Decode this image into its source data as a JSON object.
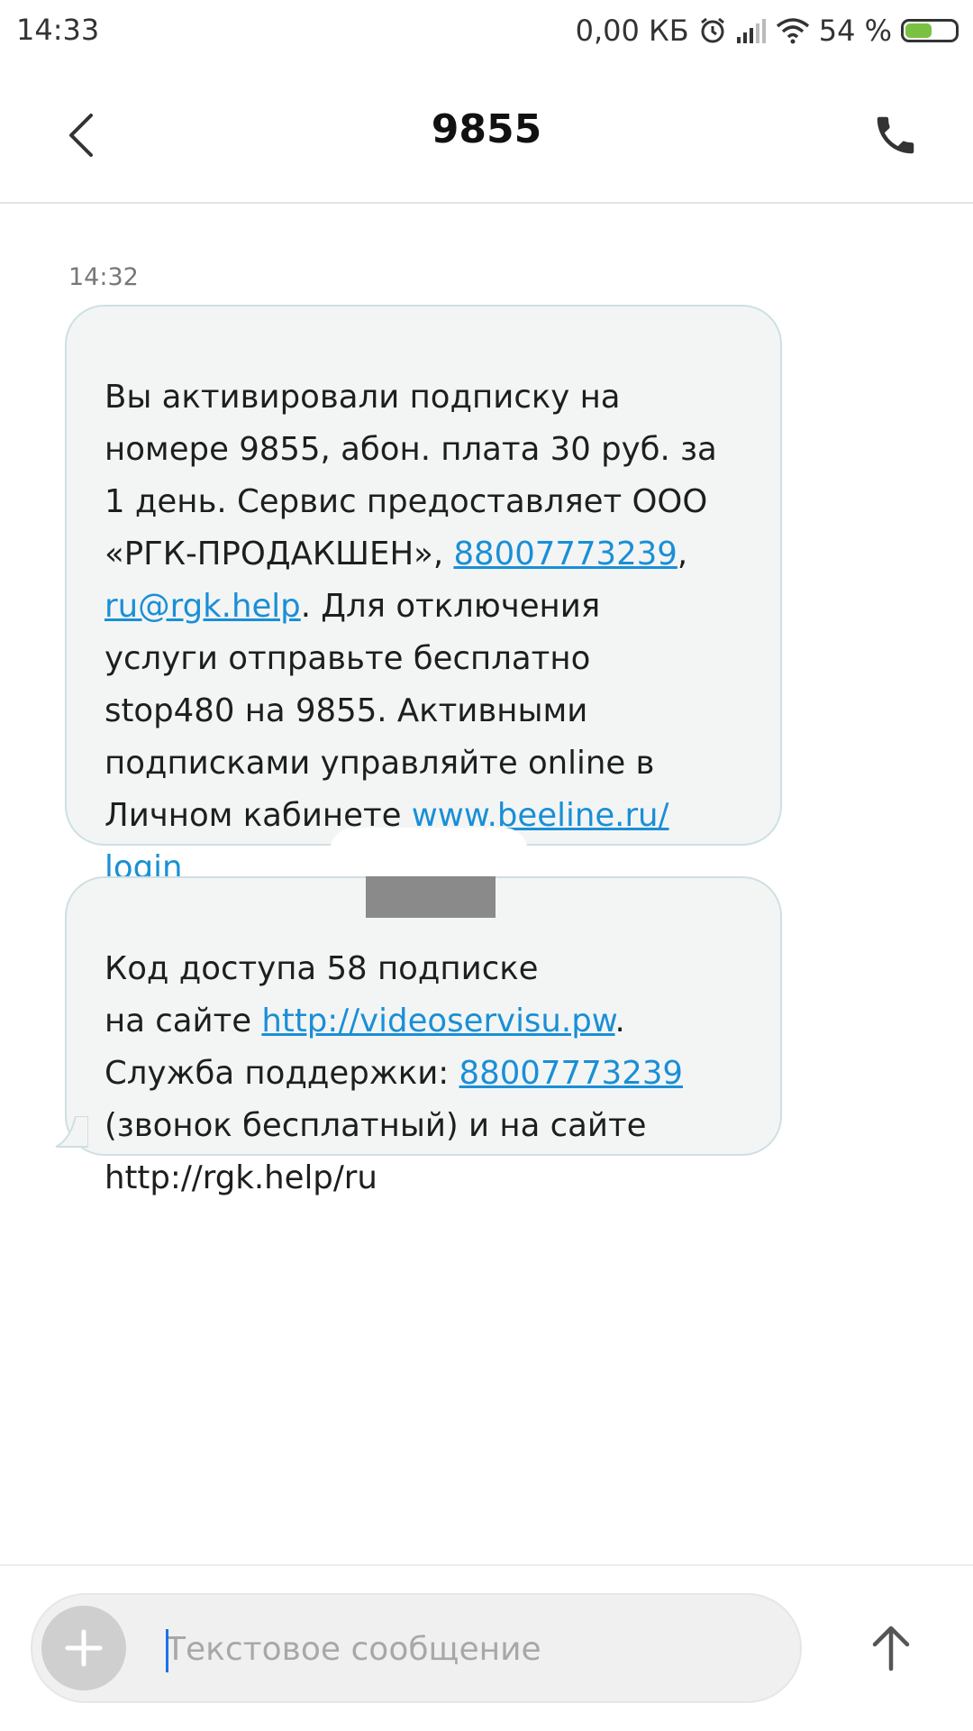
{
  "status_bar": {
    "time": "14:33",
    "data_speed": "0,00 КБ",
    "battery_percent_text": "54 %",
    "battery_level": 0.54,
    "icons": [
      "alarm-icon",
      "signal-icon",
      "wifi-icon",
      "battery-icon"
    ]
  },
  "header": {
    "title": "9855",
    "back_icon": "chevron-left-icon",
    "call_icon": "phone-icon"
  },
  "conversation": {
    "timestamp": "14:32",
    "messages": [
      {
        "parts": [
          {
            "text": "Вы активировали подписку на\nномере 9855, абон. плата 30 руб. за\n1 день. Сервис предоставляет ООО\n«РГК-ПРОДАКШЕН», ",
            "link": false
          },
          {
            "text": "88007773239",
            "link": true
          },
          {
            "text": ",\n",
            "link": false
          },
          {
            "text": "ru@rgk.help",
            "link": true
          },
          {
            "text": ". Для отключения\nуслуги отправьте бесплатно\nstop480 на 9855. Активными\nподписками управляйте online в\nЛичном кабинете ",
            "link": false
          },
          {
            "text": "www.beeline.ru/\nlogin",
            "link": true
          }
        ]
      },
      {
        "parts": [
          {
            "text": "Код доступа 58",
            "link": false
          },
          {
            "text": "                      подписке\nна сайте ",
            "link": false
          },
          {
            "text": "http://videoservisu.pw",
            "link": true
          },
          {
            "text": ".\nСлужба поддержки: ",
            "link": false
          },
          {
            "text": "88007773239",
            "link": true
          },
          {
            "text": "\n(звонок бесплатный) и на сайте\nhttp://rgk.help/ru",
            "link": false
          }
        ]
      }
    ]
  },
  "composer": {
    "placeholder": "Текстовое сообщение",
    "value": "",
    "add_icon": "plus-icon",
    "send_icon": "arrow-up-icon"
  },
  "colors": {
    "link": "#1a8fd6",
    "bubble_bg": "#f3f5f5",
    "bubble_border": "#cfdfe3",
    "battery_fill": "#7ac143",
    "caret": "#1a73e8"
  }
}
